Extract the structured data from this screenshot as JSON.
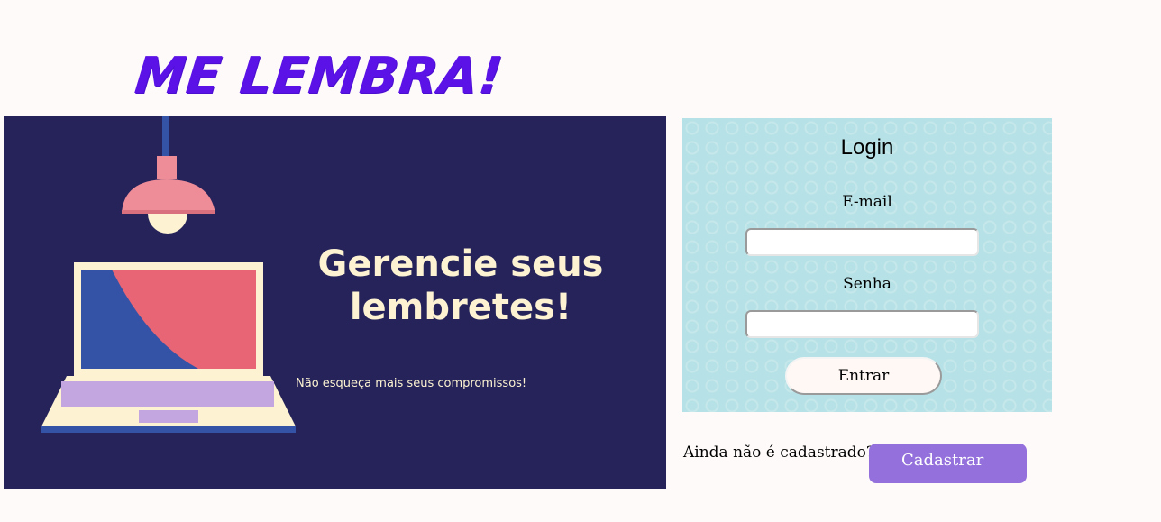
{
  "logo": {
    "text": "ME LEMBRA!"
  },
  "hero": {
    "title": "Gerencie seus lembretes!",
    "subtitle": "Não esqueça mais seus compromissos!"
  },
  "login": {
    "title": "Login",
    "email_label": "E-mail",
    "email_value": "",
    "password_label": "Senha",
    "password_value": "",
    "submit_label": "Entrar"
  },
  "signup": {
    "prompt": "Ainda não é cadastrado?",
    "button_label": "Cadastrar"
  },
  "colors": {
    "logo": "#5a12e6",
    "hero_background": "#25235a",
    "login_panel": "#b6e1e6",
    "signup_button": "#9370db"
  }
}
